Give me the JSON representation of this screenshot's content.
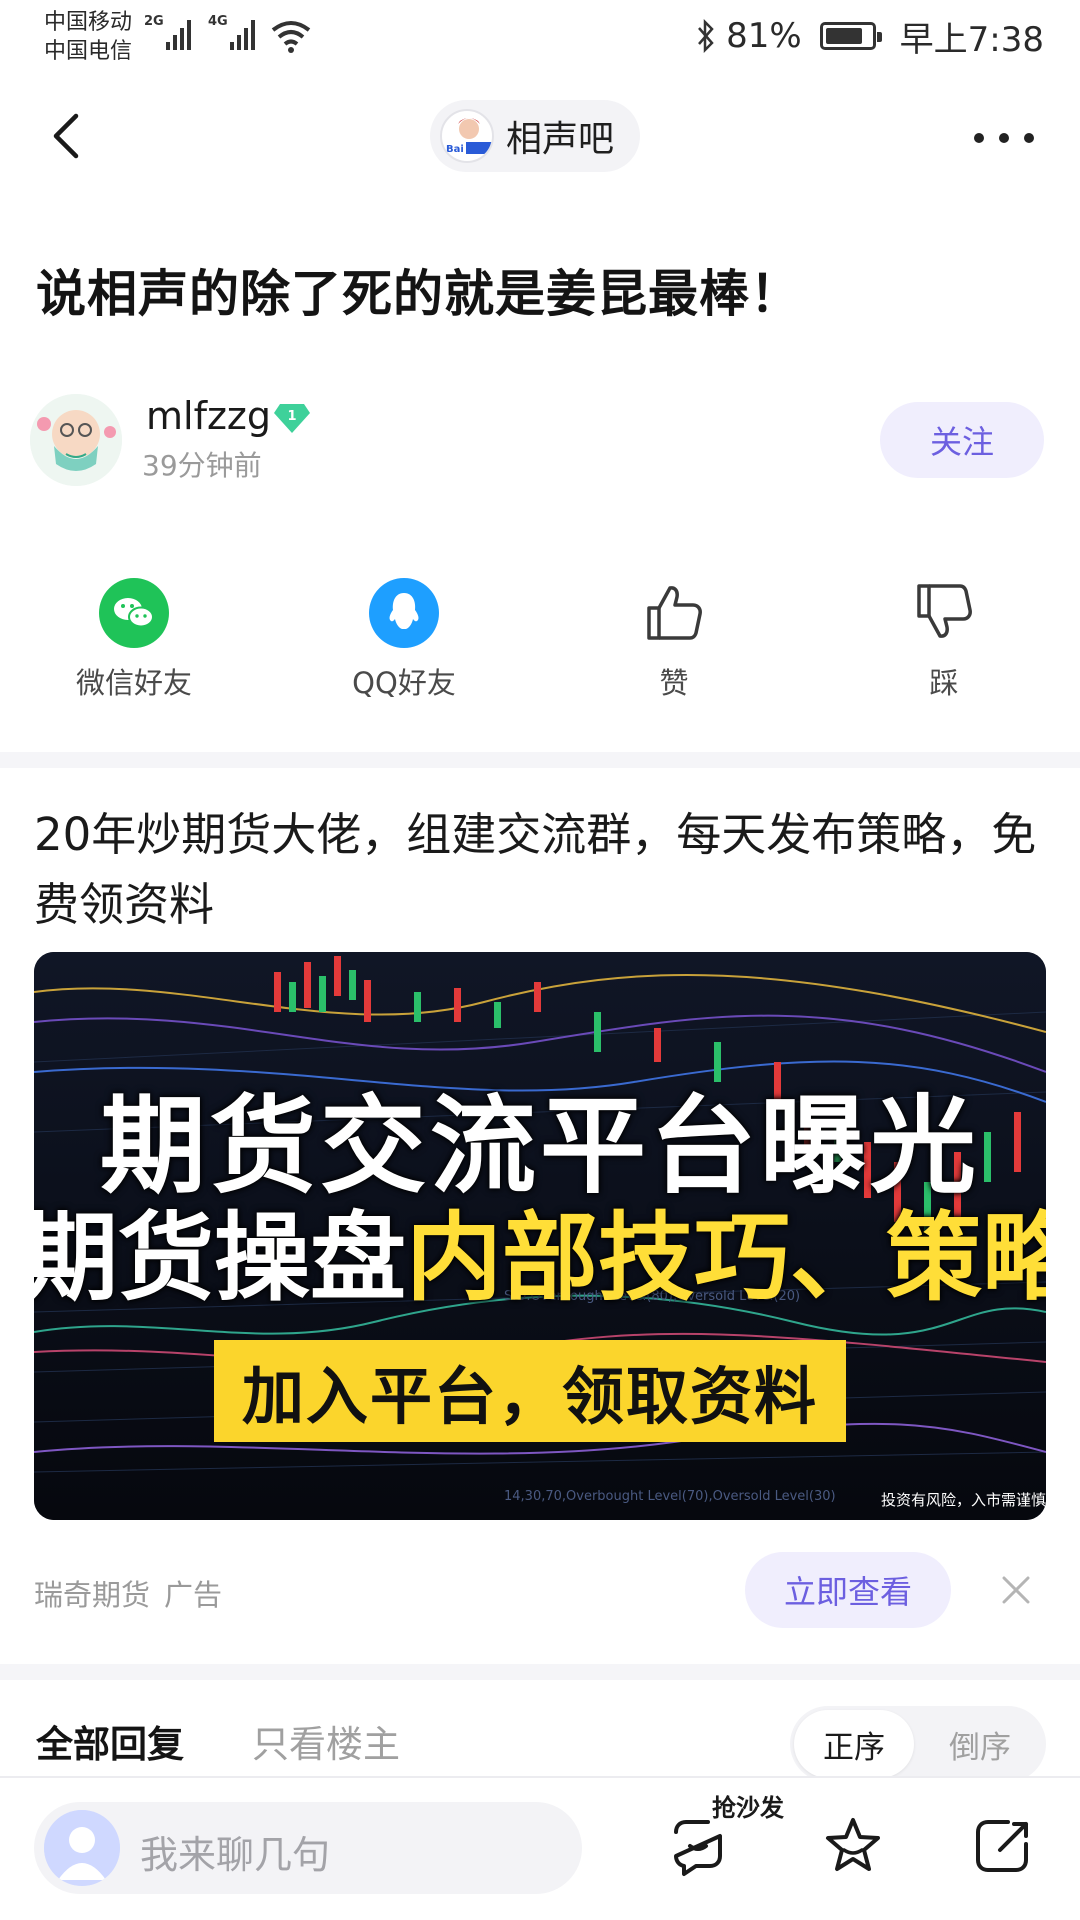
{
  "status_bar": {
    "carrier1": "中国移动",
    "carrier2": "中国电信",
    "net1": "2G",
    "net2": "4G",
    "battery": "81%",
    "battery_level": 0.81,
    "time": "早上7:38"
  },
  "nav": {
    "forum_name": "相声吧",
    "forum_logo_text": "Bai 相声吧"
  },
  "post": {
    "title": "说相声的除了死的就是姜昆最棒！",
    "author": "mlfzzg",
    "level": "1",
    "time": "39分钟前",
    "follow_label": "关注"
  },
  "share": {
    "wechat": "微信好友",
    "qq": "QQ好友",
    "like": "赞",
    "dislike": "踩"
  },
  "ad": {
    "text": "20年炒期货大佬，组建交流群，每天发布策略，免费领资料",
    "banner_line1": "期货交流平台曝光",
    "banner_line2_white": "期货操盘",
    "banner_line2_yellow": "内部技巧、策略",
    "banner_cta": "加入平台，领取资料",
    "banner_risk": "投资有风险，入市需谨慎",
    "chart_label1": "S.D.Overbought Level(80),Oversold Level(20)",
    "chart_label2": "14,30,70,Overbought Level(70),Oversold Level(30)",
    "source": "瑞奇期货",
    "tag": "广告",
    "view_label": "立即查看"
  },
  "replies": {
    "tab_all": "全部回复",
    "tab_op": "只看楼主",
    "sort_asc": "正序",
    "sort_desc": "倒序"
  },
  "bottom": {
    "placeholder": "我来聊几句",
    "sofa": "抢沙发"
  },
  "colors": {
    "accent": "#6c5fe0",
    "accent_bg": "#f0eefd",
    "wechat_green": "#1fc358",
    "qq_blue": "#1e9fff",
    "banner_yellow": "#fbd52c"
  }
}
